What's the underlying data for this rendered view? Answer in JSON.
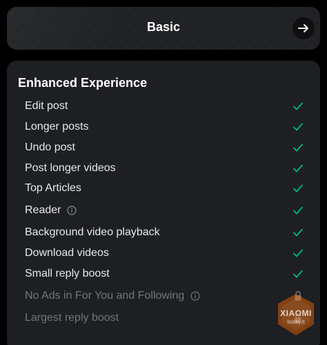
{
  "plan": {
    "title": "Basic"
  },
  "section": {
    "title": "Enhanced Experience"
  },
  "features": [
    {
      "label": "Edit post",
      "status": "included"
    },
    {
      "label": "Longer posts",
      "status": "included"
    },
    {
      "label": "Undo post",
      "status": "included"
    },
    {
      "label": "Post longer videos",
      "status": "included"
    },
    {
      "label": "Top Articles",
      "status": "included"
    },
    {
      "label": "Reader",
      "status": "included",
      "info": true
    },
    {
      "label": "Background video playback",
      "status": "included"
    },
    {
      "label": "Download videos",
      "status": "included"
    },
    {
      "label": "Small reply boost",
      "status": "included"
    },
    {
      "label": "No Ads in For You and Following",
      "status": "locked",
      "info": true
    },
    {
      "label": "Largest reply boost",
      "status": "locked"
    }
  ],
  "watermark": {
    "line1": "XIAOMI",
    "line2": "today.it"
  },
  "colors": {
    "check": "#00ba7c",
    "muted": "#71767b",
    "card": "#1d1f23",
    "background": "#000000"
  }
}
